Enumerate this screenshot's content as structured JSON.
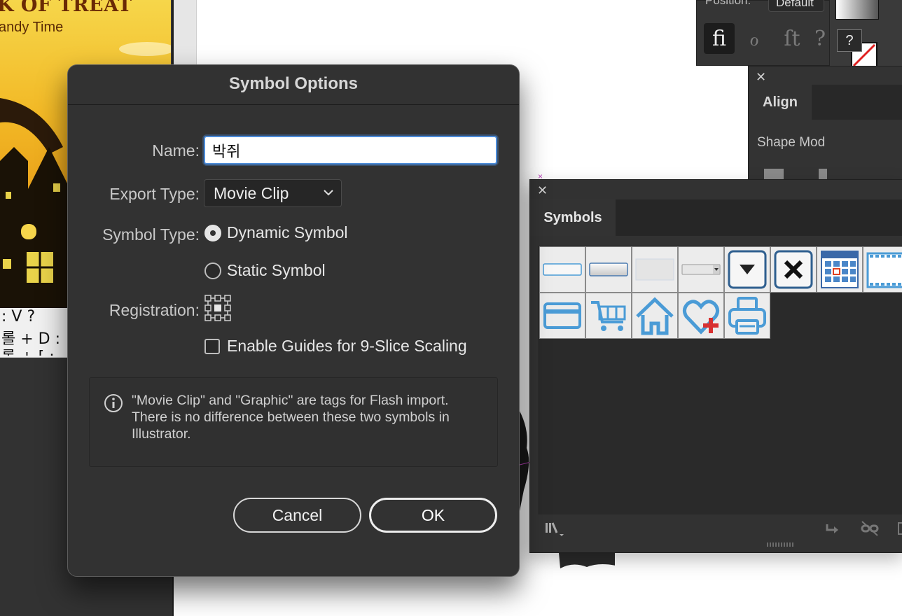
{
  "dialog": {
    "title": "Symbol Options",
    "name_label": "Name:",
    "name_value": "박쥐",
    "export_type_label": "Export Type:",
    "export_type_value": "Movie Clip",
    "symbol_type_label": "Symbol Type:",
    "radio_dynamic": "Dynamic Symbol",
    "radio_static": "Static Symbol",
    "symbol_type_selected": "Dynamic Symbol",
    "registration_label": "Registration:",
    "nine_slice_label": "Enable Guides for 9-Slice Scaling",
    "nine_slice_checked": false,
    "info_text": "\"Movie Clip\" and \"Graphic\" are tags for Flash import. There is no difference between these two symbols in Illustrator.",
    "cancel_label": "Cancel",
    "ok_label": "OK"
  },
  "symbols_panel": {
    "tab_label": "Symbols",
    "symbols": [
      "button-blank-icon",
      "button-gray-icon",
      "button-light-icon",
      "dropdown-small-icon",
      "dropdown-arrow-icon",
      "close-x-icon",
      "calendar-icon",
      "film-strip-icon",
      "credit-card-icon",
      "shopping-cart-icon",
      "home-icon",
      "heart-plus-icon",
      "printer-icon"
    ],
    "accent_blue": "#4a9bd6"
  },
  "align_panel": {
    "tab_label": "Align",
    "section_label": "Shape Mod"
  },
  "char_panel": {
    "position_label": "Position:",
    "position_value": "Default",
    "glyphs": [
      "ﬁ",
      "ℴ",
      "ſt",
      "?"
    ]
  },
  "poster": {
    "title": "K OF TREAT",
    "subtitle": "andy Time",
    "text_lines": [
      ": V  ?",
      "롤 + D  :",
      "롤 + [  :"
    ]
  },
  "tools": {
    "unknown_swatch_label": "?"
  }
}
